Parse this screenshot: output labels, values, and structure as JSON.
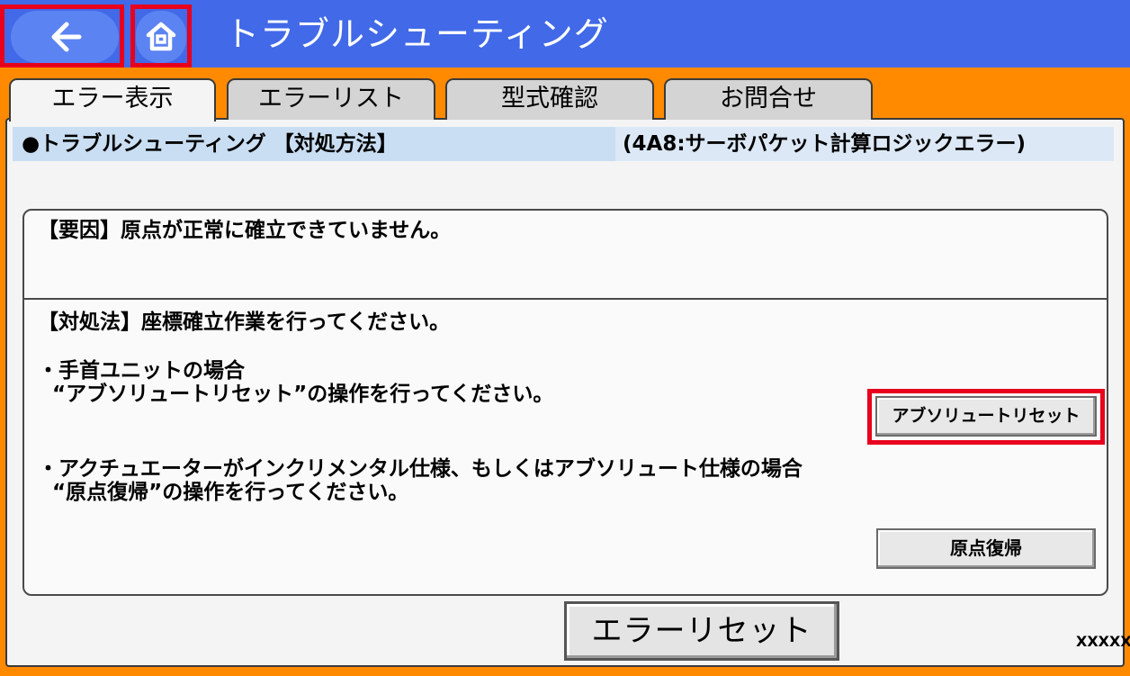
{
  "header": {
    "title": "トラブルシューティング",
    "back_icon": "arrow-left-icon",
    "home_icon": "home-icon"
  },
  "tabs": [
    {
      "label": "エラー表示",
      "active": true
    },
    {
      "label": "エラーリスト",
      "active": false
    },
    {
      "label": "型式確認",
      "active": false
    },
    {
      "label": "お問合せ",
      "active": false
    }
  ],
  "subheader": {
    "left": "●トラブルシューティング 【対処方法】",
    "right": "(4A8:サーボパケット計算ロジックエラー)"
  },
  "content": {
    "cause": "【要因】原点が正常に確立できていません。",
    "remedy": "【対処法】座標確立作業を行ってください。",
    "bullet1_line1": "・手首ユニットの場合",
    "bullet1_line2": "  “アブソリュートリセット”の操作を行ってください。",
    "bullet2_line1": "・アクチュエーターがインクリメンタル仕様、もしくはアブソリュート仕様の場合",
    "bullet2_line2": "  “原点復帰”の操作を行ってください。"
  },
  "buttons": {
    "absolute_reset": "アブソリュートリセット",
    "origin_return": "原点復帰",
    "error_reset": "エラーリセット"
  },
  "footer_code": "XXXXX",
  "colors": {
    "header": "#4169e8",
    "background": "#ff8a00",
    "highlight": "#e8001c",
    "subheader": "#c9def2"
  }
}
